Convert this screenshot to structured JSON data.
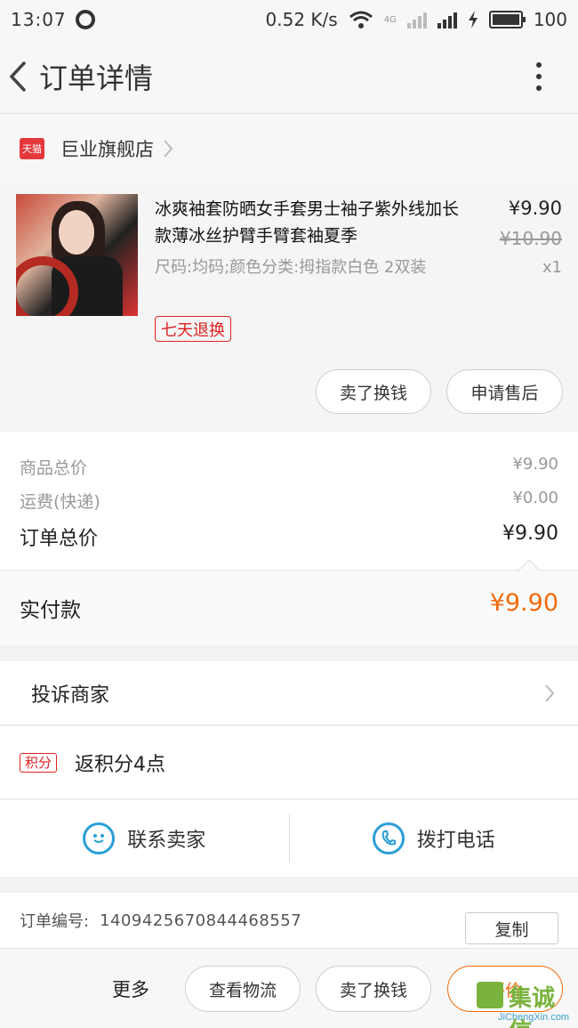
{
  "status_bar": {
    "time": "13:07",
    "speed": "0.52 K/s",
    "network": "4G",
    "battery": "100"
  },
  "navbar": {
    "title": "订单详情"
  },
  "shop": {
    "badge": "天猫",
    "name": "巨业旗舰店"
  },
  "product": {
    "title": "冰爽袖套防晒女手套男士袖子紫外线加长款薄冰丝护臂手臂套袖夏季",
    "spec": "尺码:均码;颜色分类:拇指款白色 2双装",
    "price": "¥9.90",
    "original_price": "¥10.90",
    "quantity": "x1",
    "tag": "七天退换",
    "actions": {
      "sell_exchange": "卖了换钱",
      "after_sale": "申请售后"
    }
  },
  "summary": {
    "goods_total_label": "商品总价",
    "goods_total": "¥9.90",
    "shipping_label": "运费(快递)",
    "shipping": "¥0.00",
    "order_total_label": "订单总价",
    "order_total": "¥9.90"
  },
  "paid": {
    "label": "实付款",
    "value": "¥9.90"
  },
  "complain": {
    "label": "投诉商家"
  },
  "points": {
    "badge": "积分",
    "label": "返积分4点"
  },
  "contact": {
    "seller_label": "联系卖家",
    "call_label": "拨打电话"
  },
  "order": {
    "number_label": "订单编号:",
    "number": "1409425670844468557",
    "copy_label": "复制"
  },
  "bottom_bar": {
    "more": "更多",
    "logistics": "查看物流",
    "sell_exchange": "卖了换钱",
    "review": "评价"
  },
  "watermark": {
    "text": "集诚信",
    "url": "JiChengXin.com"
  },
  "colors": {
    "accent": "#f26a0c",
    "tmall_red": "#e4393c",
    "link_blue": "#2a9fd8"
  }
}
